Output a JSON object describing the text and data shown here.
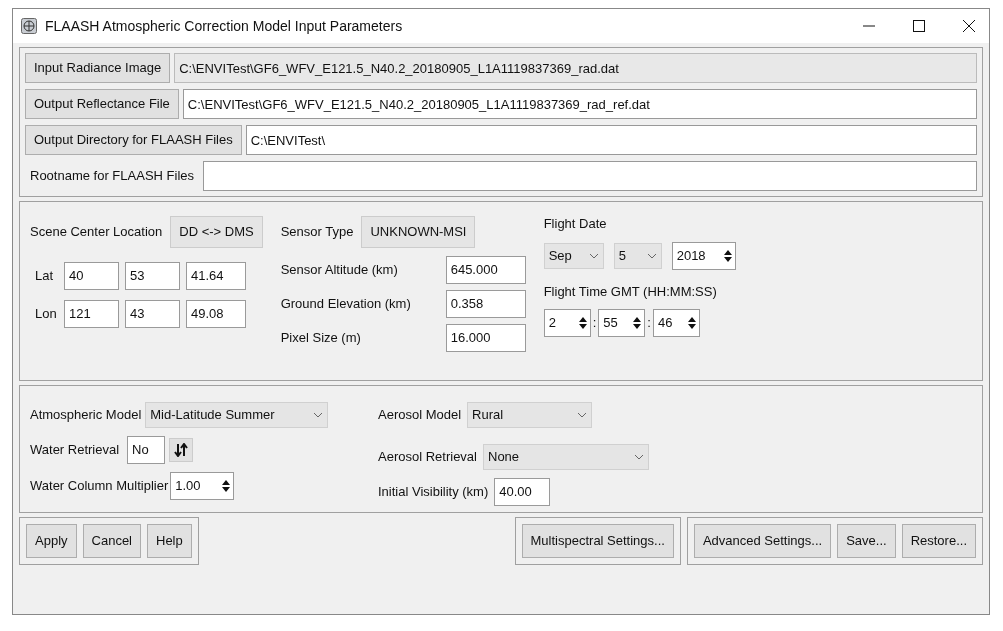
{
  "window": {
    "title": "FLAASH Atmospheric Correction Model Input Parameters"
  },
  "files": [
    {
      "kind": "button",
      "label": "Input Radiance Image",
      "value": "C:\\ENVITest\\GF6_WFV_E121.5_N40.2_20180905_L1A1119837369_rad.dat",
      "readonly": true
    },
    {
      "kind": "button",
      "label": "Output Reflectance File",
      "value": "C:\\ENVITest\\GF6_WFV_E121.5_N40.2_20180905_L1A1119837369_rad_ref.dat",
      "readonly": false
    },
    {
      "kind": "button",
      "label": "Output Directory for FLAASH Files",
      "value": "C:\\ENVITest\\",
      "readonly": false
    },
    {
      "kind": "label",
      "label": "Rootname for FLAASH Files",
      "readonly": false
    }
  ],
  "scene": {
    "label": "Scene Center Location",
    "toggle": "DD <-> DMS",
    "coords": [
      {
        "label": "Lat",
        "values": [
          "40",
          "53",
          "41.64"
        ]
      },
      {
        "label": "Lon",
        "values": [
          "121",
          "43",
          "49.08"
        ]
      }
    ]
  },
  "sensor": {
    "type_label": "Sensor Type",
    "type_value": "UNKNOWN-MSI",
    "fields": [
      {
        "label": "Sensor Altitude (km)",
        "value": "645.000"
      },
      {
        "label": "Ground Elevation (km)",
        "value": "0.358"
      },
      {
        "label": "Pixel Size (m)",
        "value": "16.000"
      }
    ]
  },
  "flight": {
    "date_label": "Flight Date",
    "month": "Sep",
    "day": "5",
    "year": "2018",
    "time_label": "Flight Time GMT (HH:MM:SS)",
    "time": [
      {
        "value": "2"
      },
      {
        "prefix": ":",
        "value": "55"
      },
      {
        "prefix": ":",
        "value": "46"
      }
    ]
  },
  "atmosphere": {
    "atmospheric_model": {
      "label": "Atmospheric Model",
      "value": "Mid-Latitude Summer"
    },
    "water_retrieval": {
      "label": "Water Retrieval",
      "value": "No"
    },
    "water_column_multiplier": {
      "label": "Water Column Multiplier",
      "value": "1.00"
    },
    "aerosol_model": {
      "label": "Aerosol Model",
      "value": "Rural"
    },
    "aerosol_retrieval": {
      "label": "Aerosol Retrieval",
      "value": "None"
    },
    "initial_visibility": {
      "label": "Initial Visibility (km)",
      "value": "40.00"
    }
  },
  "button_groups": [
    [
      "Apply",
      "Cancel",
      "Help"
    ],
    [
      "Multispectral Settings..."
    ],
    [
      "Advanced Settings...",
      "Save...",
      "Restore..."
    ]
  ]
}
